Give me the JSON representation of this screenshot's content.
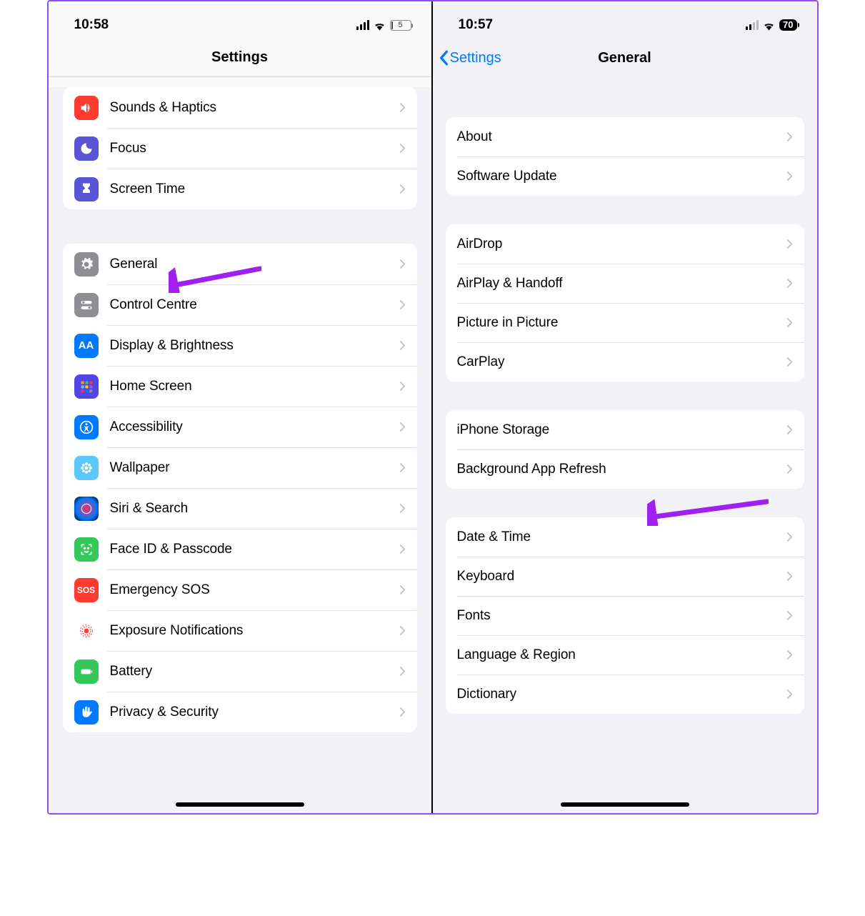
{
  "left": {
    "status": {
      "time": "10:58",
      "battery_text": "5"
    },
    "nav": {
      "title": "Settings"
    },
    "groups": [
      [
        {
          "id": "sounds",
          "label": "Sounds & Haptics",
          "icon": "speaker",
          "color": "ico-red"
        },
        {
          "id": "focus",
          "label": "Focus",
          "icon": "moon",
          "color": "ico-indigo"
        },
        {
          "id": "screentime",
          "label": "Screen Time",
          "icon": "hourglass",
          "color": "ico-indigo"
        }
      ],
      [
        {
          "id": "general",
          "label": "General",
          "icon": "gear",
          "color": "ico-gray"
        },
        {
          "id": "controlcentre",
          "label": "Control Centre",
          "icon": "toggles",
          "color": "ico-gray"
        },
        {
          "id": "display",
          "label": "Display & Brightness",
          "icon": "aa",
          "color": "ico-blue"
        },
        {
          "id": "homescreen",
          "label": "Home Screen",
          "icon": "apps",
          "color": "ico-home"
        },
        {
          "id": "accessibility",
          "label": "Accessibility",
          "icon": "access",
          "color": "ico-blue"
        },
        {
          "id": "wallpaper",
          "label": "Wallpaper",
          "icon": "flower",
          "color": "ico-teal"
        },
        {
          "id": "siri",
          "label": "Siri & Search",
          "icon": "siri",
          "color": "ico-siri"
        },
        {
          "id": "faceid",
          "label": "Face ID & Passcode",
          "icon": "face",
          "color": "ico-green"
        },
        {
          "id": "sos",
          "label": "Emergency SOS",
          "icon": "sos",
          "color": "ico-sos"
        },
        {
          "id": "exposure",
          "label": "Exposure Notifications",
          "icon": "exposure",
          "color": "ico-white"
        },
        {
          "id": "battery",
          "label": "Battery",
          "icon": "battery",
          "color": "ico-green"
        },
        {
          "id": "privacy",
          "label": "Privacy & Security",
          "icon": "hand",
          "color": "ico-borb"
        }
      ]
    ]
  },
  "right": {
    "status": {
      "time": "10:57",
      "battery_text": "70"
    },
    "nav": {
      "title": "General",
      "back": "Settings"
    },
    "groups": [
      [
        {
          "id": "about",
          "label": "About"
        },
        {
          "id": "update",
          "label": "Software Update"
        }
      ],
      [
        {
          "id": "airdrop",
          "label": "AirDrop"
        },
        {
          "id": "airplay",
          "label": "AirPlay & Handoff"
        },
        {
          "id": "pip",
          "label": "Picture in Picture"
        },
        {
          "id": "carplay",
          "label": "CarPlay"
        }
      ],
      [
        {
          "id": "storage",
          "label": "iPhone Storage"
        },
        {
          "id": "refresh",
          "label": "Background App Refresh"
        }
      ],
      [
        {
          "id": "datetime",
          "label": "Date & Time"
        },
        {
          "id": "keyboard",
          "label": "Keyboard"
        },
        {
          "id": "fonts",
          "label": "Fonts"
        },
        {
          "id": "language",
          "label": "Language & Region"
        },
        {
          "id": "dict",
          "label": "Dictionary"
        }
      ]
    ]
  },
  "annotations": {
    "arrow_color": "#a020f0"
  }
}
